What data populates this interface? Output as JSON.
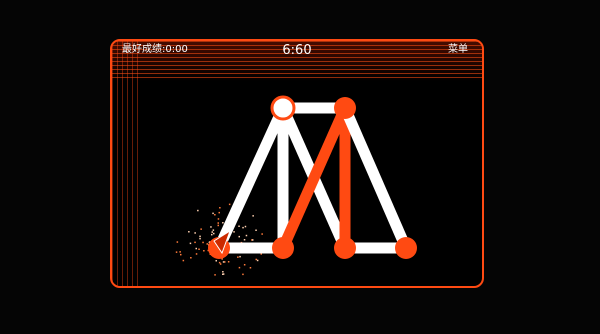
{
  "hud": {
    "best_score": "最好成绩:0:00",
    "timer": "6:60",
    "menu_label": "菜单"
  },
  "colors": {
    "accent": "#ff4a12",
    "line_drawn": "#ff4a12",
    "line_pending": "#ffffff",
    "background": "#000000"
  },
  "puzzle": {
    "nodes": [
      {
        "id": "top-left",
        "state": "start"
      },
      {
        "id": "top-right",
        "state": "visited"
      },
      {
        "id": "bottom-a",
        "state": "visited"
      },
      {
        "id": "bottom-b",
        "state": "visited"
      },
      {
        "id": "bottom-c",
        "state": "visited"
      },
      {
        "id": "bottom-d",
        "state": "visited"
      }
    ],
    "edges": [
      {
        "from": "top-left",
        "to": "top-right",
        "state": "pending"
      },
      {
        "from": "top-left",
        "to": "bottom-a",
        "state": "pending"
      },
      {
        "from": "top-left",
        "to": "bottom-c",
        "state": "pending"
      },
      {
        "from": "top-left",
        "to": "bottom-b",
        "state": "pending"
      },
      {
        "from": "top-right",
        "to": "bottom-b",
        "state": "drawn"
      },
      {
        "from": "top-right",
        "to": "bottom-c",
        "state": "drawn"
      },
      {
        "from": "top-right",
        "to": "bottom-d",
        "state": "pending"
      },
      {
        "from": "bottom-a",
        "to": "bottom-b",
        "state": "pending"
      },
      {
        "from": "bottom-c",
        "to": "bottom-d",
        "state": "pending"
      }
    ],
    "cursor": "pen-cursor-icon"
  }
}
